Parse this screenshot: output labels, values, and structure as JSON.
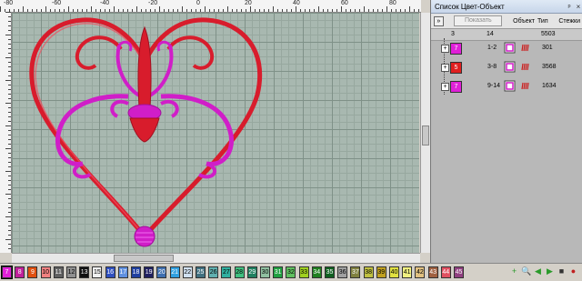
{
  "ruler": {
    "top_labels": [
      "-80",
      "-60",
      "-40",
      "-20",
      "0",
      "20",
      "40",
      "60",
      "80"
    ]
  },
  "panel": {
    "title": "Список Цвет-Объект",
    "title_buttons": {
      "pin": "ᵖ",
      "close": "×"
    },
    "show_button": "Показать",
    "col_object": "Объект",
    "col_type": "Тип",
    "col_stitches": "Стежки",
    "summary": {
      "colors": "3",
      "objects": "14",
      "stitches": "5503"
    },
    "rows": [
      {
        "color_num": "7",
        "color": "#e020d8",
        "range": "1-2",
        "stitches": "301",
        "type_color": "#cc1e1e"
      },
      {
        "color_num": "5",
        "color": "#e02020",
        "range": "3-8",
        "stitches": "3568",
        "type_color": "#cc1e1e"
      },
      {
        "color_num": "7",
        "color": "#e020d8",
        "range": "9-14",
        "stitches": "1634",
        "type_color": "#cc1e1e"
      }
    ]
  },
  "palette": [
    {
      "n": "7",
      "c": "#e020d8",
      "fg": "#fff"
    },
    {
      "n": "8",
      "c": "#c0209a",
      "fg": "#fff"
    },
    {
      "n": "9",
      "c": "#e05010",
      "fg": "#fff"
    },
    {
      "n": "10",
      "c": "#f08080",
      "fg": "#000"
    },
    {
      "n": "11",
      "c": "#606060",
      "fg": "#fff"
    },
    {
      "n": "12",
      "c": "#909090",
      "fg": "#000"
    },
    {
      "n": "13",
      "c": "#101010",
      "fg": "#fff"
    },
    {
      "n": "15",
      "c": "#f0f0f0",
      "fg": "#000"
    },
    {
      "n": "16",
      "c": "#3050c0",
      "fg": "#fff"
    },
    {
      "n": "17",
      "c": "#6090e0",
      "fg": "#fff"
    },
    {
      "n": "18",
      "c": "#2040a0",
      "fg": "#fff"
    },
    {
      "n": "19",
      "c": "#202060",
      "fg": "#fff"
    },
    {
      "n": "20",
      "c": "#4070b0",
      "fg": "#fff"
    },
    {
      "n": "21",
      "c": "#30a0e0",
      "fg": "#fff"
    },
    {
      "n": "22",
      "c": "#d0e0f0",
      "fg": "#000"
    },
    {
      "n": "25",
      "c": "#407080",
      "fg": "#fff"
    },
    {
      "n": "26",
      "c": "#60b0b0",
      "fg": "#000"
    },
    {
      "n": "27",
      "c": "#30b0a0",
      "fg": "#000"
    },
    {
      "n": "28",
      "c": "#40c080",
      "fg": "#000"
    },
    {
      "n": "29",
      "c": "#208060",
      "fg": "#fff"
    },
    {
      "n": "30",
      "c": "#90c0a0",
      "fg": "#000"
    },
    {
      "n": "31",
      "c": "#20a040",
      "fg": "#fff"
    },
    {
      "n": "32",
      "c": "#60c060",
      "fg": "#000"
    },
    {
      "n": "33",
      "c": "#a0d020",
      "fg": "#000"
    },
    {
      "n": "34",
      "c": "#208020",
      "fg": "#fff"
    },
    {
      "n": "35",
      "c": "#106020",
      "fg": "#fff"
    },
    {
      "n": "36",
      "c": "#a0a0a0",
      "fg": "#000"
    },
    {
      "n": "37",
      "c": "#808040",
      "fg": "#fff"
    },
    {
      "n": "38",
      "c": "#c0c040",
      "fg": "#000"
    },
    {
      "n": "39",
      "c": "#c0a020",
      "fg": "#000"
    },
    {
      "n": "40",
      "c": "#e0e040",
      "fg": "#000"
    },
    {
      "n": "41",
      "c": "#f0f080",
      "fg": "#000"
    },
    {
      "n": "42",
      "c": "#e0c080",
      "fg": "#000"
    },
    {
      "n": "43",
      "c": "#a06040",
      "fg": "#fff"
    },
    {
      "n": "44",
      "c": "#e05060",
      "fg": "#fff"
    },
    {
      "n": "45",
      "c": "#904080",
      "fg": "#fff"
    }
  ],
  "toolbar_icons": [
    "add-icon",
    "zoom-icon",
    "arrow-left-icon",
    "arrow-right-icon",
    "stop-icon",
    "record-icon"
  ]
}
